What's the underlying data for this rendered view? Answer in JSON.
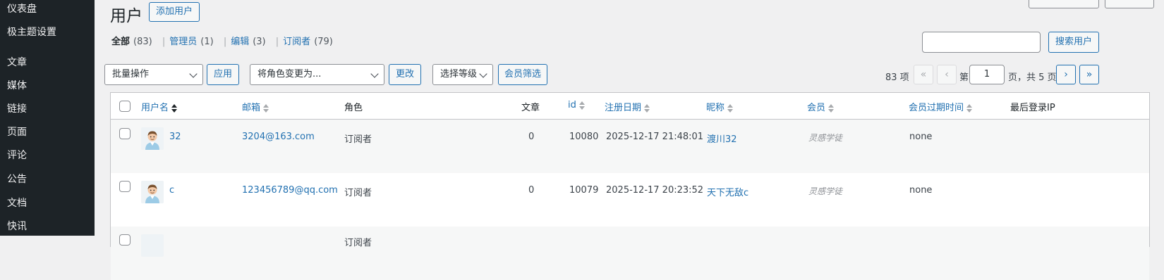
{
  "sidebar": {
    "items": [
      {
        "label": "仪表盘"
      },
      {
        "label": "极主题设置"
      },
      {
        "label": "文章"
      },
      {
        "label": "媒体"
      },
      {
        "label": "链接"
      },
      {
        "label": "页面"
      },
      {
        "label": "评论"
      },
      {
        "label": "公告"
      },
      {
        "label": "文档"
      },
      {
        "label": "快讯"
      }
    ]
  },
  "header": {
    "title": "用户",
    "add_user_label": "添加用户"
  },
  "filters": [
    {
      "label": "全部",
      "count": "(83)",
      "current": true
    },
    {
      "label": "管理员",
      "count": "(1)"
    },
    {
      "label": "编辑",
      "count": "(3)"
    },
    {
      "label": "订阅者",
      "count": "(79)"
    }
  ],
  "search": {
    "value": "",
    "button_label": "搜索用户"
  },
  "toolbar": {
    "bulk_action": "批量操作",
    "apply_label": "应用",
    "role_change": "将角色变更为...",
    "change_label": "更改",
    "level_select": "选择等级",
    "member_filter_label": "会员筛选"
  },
  "pagination": {
    "total_items": "83 项",
    "first": "«",
    "prev": "‹",
    "page_prefix": "第",
    "current_page": "1",
    "page_suffix": "页，共 5 页",
    "next": "›",
    "last": "»"
  },
  "table": {
    "columns": [
      "用户名",
      "邮箱",
      "角色",
      "文章",
      "id",
      "注册日期",
      "昵称",
      "会员",
      "会员过期时间",
      "最后登录IP"
    ],
    "rows": [
      {
        "username": "32",
        "email": "3204@163.com",
        "role": "订阅者",
        "posts": "0",
        "id": "10080",
        "registered": "2025-12-17 21:48:01",
        "nickname": "渡川32",
        "member": "灵感学徒",
        "expire": "none",
        "ip": ""
      },
      {
        "username": "c",
        "email": "123456789@qq.com",
        "role": "订阅者",
        "posts": "0",
        "id": "10079",
        "registered": "2025-12-17 20:23:52",
        "nickname": "天下无敌c",
        "member": "灵感学徒",
        "expire": "none",
        "ip": ""
      },
      {
        "role": "订阅者"
      }
    ]
  },
  "icons": {
    "avatar": "user-avatar-icon",
    "sort": "sort-arrows-icon",
    "chevron": "chevron-down-icon"
  },
  "colors": {
    "sidebar_bg": "#1d2327",
    "accent": "#2271b1",
    "page_bg": "#f0f0f1"
  }
}
